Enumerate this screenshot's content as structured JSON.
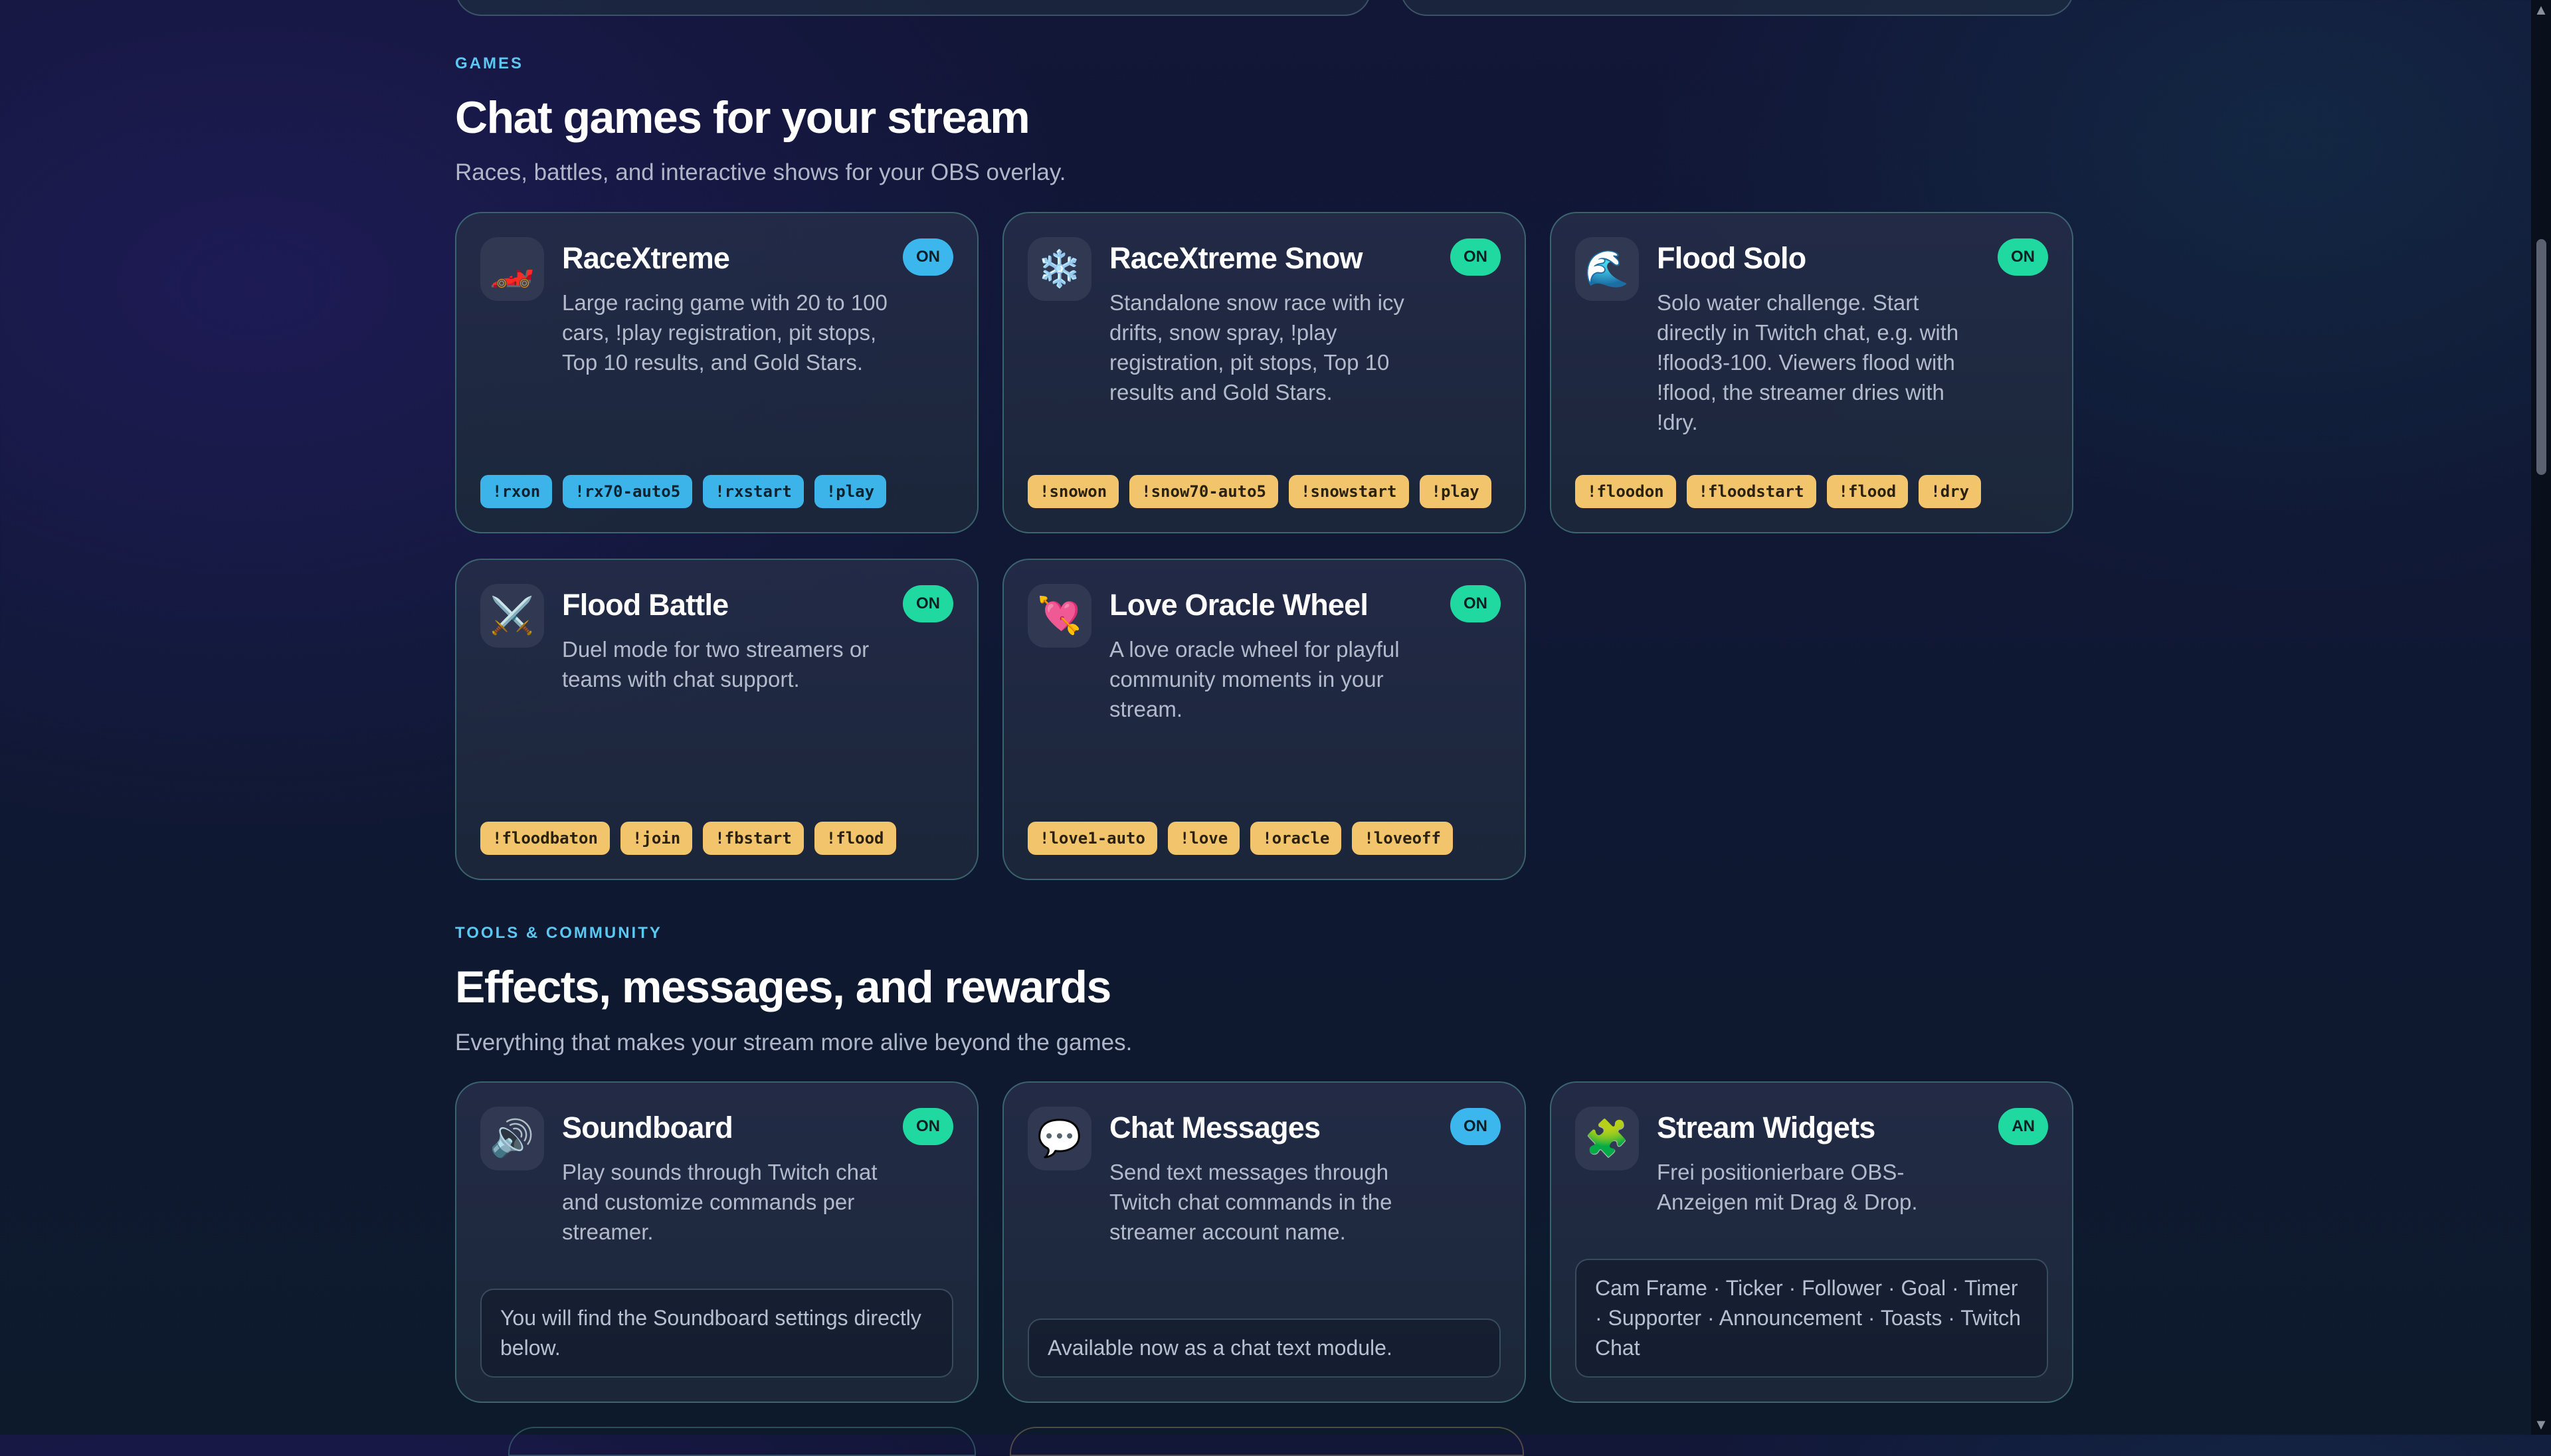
{
  "games": {
    "eyebrow": "GAMES",
    "title": "Chat games for your stream",
    "subtitle": "Races, battles, and interactive shows for your OBS overlay.",
    "cards": [
      {
        "title": "RaceXtreme",
        "desc": "Large racing game with 20 to 100 cars, !play registration, pit stops, Top 10 results, and Gold Stars.",
        "badge": "ON",
        "icon": "🏎️",
        "icon_name": "race-car-icon",
        "chips": [
          "!rxon",
          "!rx70-auto5",
          "!rxstart",
          "!play"
        ]
      },
      {
        "title": "RaceXtreme Snow",
        "desc": "Standalone snow race with icy drifts, snow spray, !play registration, pit stops, Top 10 results and Gold Stars.",
        "badge": "ON",
        "icon": "❄️",
        "icon_name": "snowflake-icon",
        "chips": [
          "!snowon",
          "!snow70-auto5",
          "!snowstart",
          "!play"
        ]
      },
      {
        "title": "Flood Solo",
        "desc": "Solo water challenge. Start directly in Twitch chat, e.g. with !flood3-100. Viewers flood with !flood, the streamer dries with !dry.",
        "badge": "ON",
        "icon": "🌊",
        "icon_name": "wave-icon",
        "chips": [
          "!floodon",
          "!floodstart",
          "!flood",
          "!dry"
        ]
      },
      {
        "title": "Flood Battle",
        "desc": "Duel mode for two streamers or teams with chat support.",
        "badge": "ON",
        "icon": "⚔️",
        "icon_name": "crossed-swords-icon",
        "chips": [
          "!floodbaton",
          "!join",
          "!fbstart",
          "!flood"
        ]
      },
      {
        "title": "Love Oracle Wheel",
        "desc": "A love oracle wheel for playful community moments in your stream.",
        "badge": "ON",
        "icon": "💘",
        "icon_name": "heart-arrow-icon",
        "chips": [
          "!love1-auto",
          "!love",
          "!oracle",
          "!loveoff"
        ]
      }
    ]
  },
  "tools": {
    "eyebrow": "TOOLS & COMMUNITY",
    "title": "Effects, messages, and rewards",
    "subtitle": "Everything that makes your stream more alive beyond the games.",
    "cards": [
      {
        "title": "Soundboard",
        "desc": "Play sounds through Twitch chat and customize commands per streamer.",
        "badge": "ON",
        "icon": "🔊",
        "icon_name": "speaker-icon",
        "note": "You will find the Soundboard settings directly below."
      },
      {
        "title": "Chat Messages",
        "desc": "Send text messages through Twitch chat commands in the streamer account name.",
        "badge": "ON",
        "icon": "💬",
        "icon_name": "speech-bubble-icon",
        "note": "Available now as a chat text module."
      },
      {
        "title": "Stream Widgets",
        "desc": "Frei positionierbare OBS-Anzeigen mit Drag & Drop.",
        "badge": "AN",
        "icon": "🧩",
        "icon_name": "puzzle-piece-icon",
        "note": "Cam Frame · Ticker · Follower · Goal · Timer · Supporter · Announcement · Toasts · Twitch Chat"
      }
    ]
  },
  "colors": {
    "accent_cyan": "#5cc8f2",
    "badge_green": "#20d9a1",
    "badge_blue": "#3cb7ee",
    "chip_blue": "#3cb4ea",
    "chip_yellow": "#f2c56c"
  }
}
